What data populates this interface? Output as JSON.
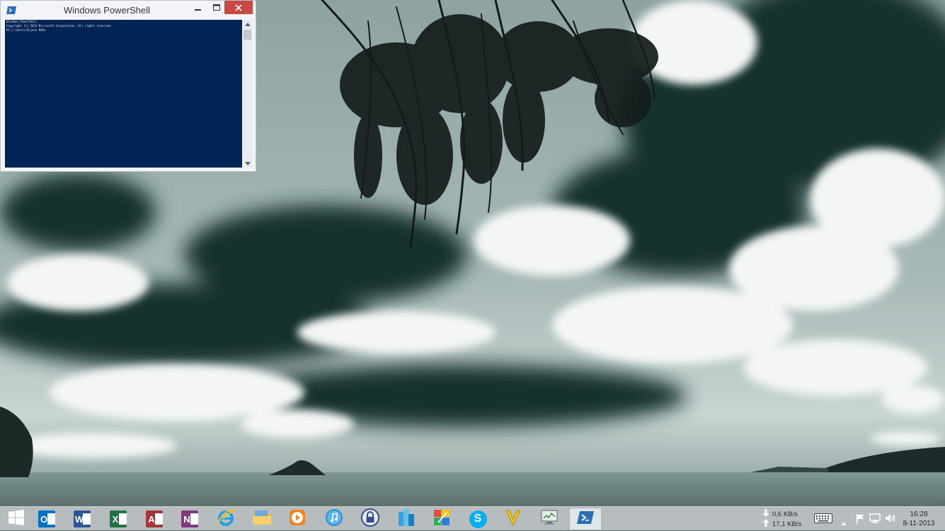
{
  "powershell": {
    "title": "Windows PowerShell",
    "lines": [
      "Windows PowerShell",
      "Copyright (C) 2013 Microsoft Corporation. All rights reserved.",
      "",
      "PS C:\\Users\\Rijnus NXD>"
    ]
  },
  "taskbar": {
    "apps": [
      {
        "name": "start",
        "icon": "windows-logo-icon"
      },
      {
        "name": "outlook",
        "icon": "outlook-icon",
        "letter": "O",
        "color": "#0072c6"
      },
      {
        "name": "word",
        "icon": "word-icon",
        "letter": "W",
        "color": "#2b579a"
      },
      {
        "name": "excel",
        "icon": "excel-icon",
        "letter": "X",
        "color": "#217346"
      },
      {
        "name": "access",
        "icon": "access-icon",
        "letter": "A",
        "color": "#a4373a"
      },
      {
        "name": "onenote",
        "icon": "onenote-icon",
        "letter": "N",
        "color": "#80397b"
      },
      {
        "name": "internet-explorer",
        "icon": "internet-explorer-icon",
        "color": "#1ea0e8"
      },
      {
        "name": "file-explorer",
        "icon": "folder-icon",
        "color": "#f2c14e"
      },
      {
        "name": "media-player",
        "icon": "media-player-icon",
        "color": "#f5821f"
      },
      {
        "name": "itunes",
        "icon": "itunes-icon",
        "color": "#2c8fd6"
      },
      {
        "name": "keepass",
        "icon": "padlock-icon",
        "color": "#3a4b8c"
      },
      {
        "name": "azure",
        "icon": "blue-buildings-icon",
        "color": "#33a3dc"
      },
      {
        "name": "paint",
        "icon": "palette-icon",
        "color": "#e84a3c"
      },
      {
        "name": "skype",
        "icon": "skype-icon",
        "letter": "S",
        "color": "#00aff0"
      },
      {
        "name": "vim",
        "icon": "v-icon",
        "letter": "V",
        "color": "#e8c020"
      },
      {
        "name": "task-manager",
        "icon": "monitor-icon",
        "color": "#d0d4d8"
      },
      {
        "name": "powershell",
        "icon": "powershell-icon",
        "color": "#2a6fb5",
        "active": true
      }
    ],
    "network": {
      "download": "0,6 KB/s",
      "upload": "17,1 KB/s"
    },
    "tray_icons": [
      "keyboard-icon",
      "chevron-up-icon",
      "flag-icon",
      "network-icon",
      "speaker-icon"
    ],
    "clock": {
      "time": "16:28",
      "date": "8-11-2013"
    }
  }
}
